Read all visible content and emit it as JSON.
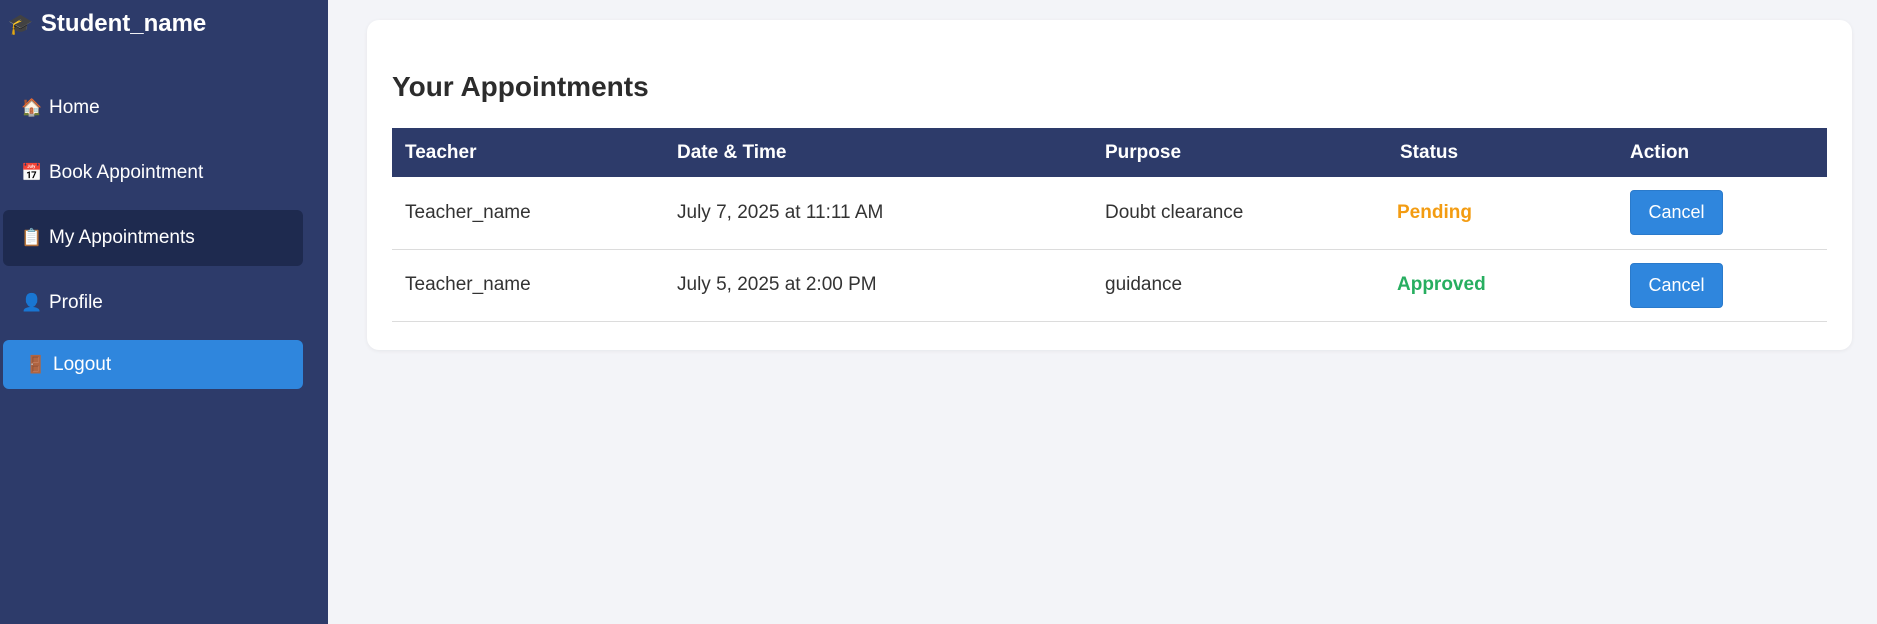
{
  "sidebar": {
    "brand": {
      "icon": "🎓",
      "label": "Student_name"
    },
    "items": [
      {
        "icon": "🏠",
        "label": "Home"
      },
      {
        "icon": "📅",
        "label": "Book Appointment"
      },
      {
        "icon": "📋",
        "label": "My Appointments",
        "active": true
      },
      {
        "icon": "👤",
        "label": "Profile"
      }
    ],
    "logout": {
      "icon": "🚪",
      "label": "Logout"
    }
  },
  "main": {
    "title": "Your Appointments",
    "columns": [
      "Teacher",
      "Date & Time",
      "Purpose",
      "Status",
      "Action"
    ],
    "rows": [
      {
        "teacher": "Teacher_name",
        "datetime": "July 7, 2025 at 11:11 AM",
        "purpose": "Doubt clearance",
        "status": "Pending",
        "action": "Cancel"
      },
      {
        "teacher": "Teacher_name",
        "datetime": "July 5, 2025 at 2:00 PM",
        "purpose": "guidance",
        "status": "Approved",
        "action": "Cancel"
      }
    ]
  },
  "colors": {
    "sidebar": "#2d3b6a",
    "active": "#1e2a4f",
    "accent": "#2f86dd",
    "pending": "#f39c12",
    "approved": "#27ae60"
  }
}
